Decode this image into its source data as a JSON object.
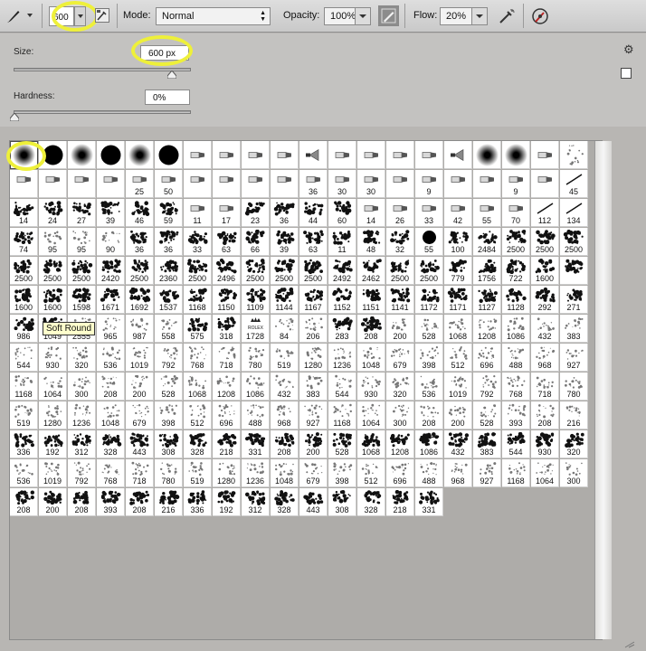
{
  "toolbar": {
    "size_value": "600",
    "mode_label": "Mode:",
    "mode_value": "Normal",
    "opacity_label": "Opacity:",
    "opacity_value": "100%",
    "flow_label": "Flow:",
    "flow_value": "20%",
    "icons": [
      "brush-tool-icon",
      "tool-preset-chevron-icon",
      "brush-panel-toggle-icon",
      "pressure-opacity-icon",
      "airbrush-icon",
      "pressure-size-icon"
    ]
  },
  "panel": {
    "size_label": "Size:",
    "size_value": "600 px",
    "size_slider_fraction": 0.6,
    "hardness_label": "Hardness:",
    "hardness_value": "0%",
    "hardness_slider_fraction": 0.0,
    "icons": [
      "gear-icon",
      "new-preset-icon"
    ]
  },
  "tooltip": "Soft Round",
  "colors": {
    "highlight": "#eef03a",
    "panel": "#c3c2c0",
    "picker_bg": "#aeaca9"
  },
  "presets": {
    "rows": [
      [
        "",
        "",
        "",
        "",
        "",
        "",
        "",
        "",
        "",
        "",
        "",
        "",
        "",
        "",
        "",
        "",
        "",
        "",
        "",
        ""
      ],
      [
        "",
        "",
        "",
        "",
        "25",
        "50",
        "",
        "",
        "",
        "",
        "36",
        "30",
        "30",
        "",
        "9",
        "",
        "",
        "9",
        "",
        "45"
      ],
      [
        "14",
        "24",
        "27",
        "39",
        "46",
        "59",
        "11",
        "17",
        "23",
        "36",
        "44",
        "60",
        "14",
        "26",
        "33",
        "42",
        "55",
        "70",
        "112",
        "134"
      ],
      [
        "74",
        "95",
        "95",
        "90",
        "36",
        "36",
        "33",
        "63",
        "66",
        "39",
        "63",
        "11",
        "48",
        "32",
        "55",
        "100",
        "2484",
        "2500",
        "2500",
        "2500"
      ],
      [
        "2500",
        "2500",
        "2500",
        "2420",
        "2500",
        "2360",
        "2500",
        "2496",
        "2500",
        "2500",
        "2500",
        "2492",
        "2462",
        "2500",
        "2500",
        "779",
        "1756",
        "722",
        "1600",
        ""
      ],
      [
        "1600",
        "1600",
        "1598",
        "1671",
        "1692",
        "1537",
        "1168",
        "1150",
        "1109",
        "1144",
        "1167",
        "1152",
        "1151",
        "1141",
        "1172",
        "1171",
        "1127",
        "1128",
        "292",
        "271"
      ],
      [
        "986",
        "1049",
        "2555",
        "965",
        "987",
        "558",
        "575",
        "318",
        "1728",
        "84",
        "206",
        "283",
        "208",
        "200",
        "528",
        "1068",
        "1208",
        "1086",
        "432",
        "383"
      ],
      [
        "544",
        "930",
        "320",
        "536",
        "1019",
        "792",
        "768",
        "718",
        "780",
        "519",
        "1280",
        "1236",
        "1048",
        "679",
        "398",
        "512",
        "696",
        "488",
        "968",
        "927"
      ],
      [
        "1168",
        "1064",
        "300",
        "208",
        "200",
        "528",
        "1068",
        "1208",
        "1086",
        "432",
        "383",
        "544",
        "930",
        "320",
        "536",
        "1019",
        "792",
        "768",
        "718",
        "780"
      ],
      [
        "519",
        "1280",
        "1236",
        "1048",
        "679",
        "398",
        "512",
        "696",
        "488",
        "968",
        "927",
        "1168",
        "1064",
        "300",
        "208",
        "200",
        "528",
        "393",
        "208",
        "216"
      ],
      [
        "336",
        "192",
        "312",
        "328",
        "443",
        "308",
        "328",
        "218",
        "331",
        "208",
        "200",
        "528",
        "1068",
        "1208",
        "1086",
        "432",
        "383",
        "544",
        "930",
        "320"
      ],
      [
        "536",
        "1019",
        "792",
        "768",
        "718",
        "780",
        "519",
        "1280",
        "1236",
        "1048",
        "679",
        "398",
        "512",
        "696",
        "488",
        "968",
        "927",
        "1168",
        "1064",
        "300"
      ],
      [
        "208",
        "200",
        "208",
        "393",
        "208",
        "216",
        "336",
        "192",
        "312",
        "328",
        "443",
        "308",
        "328",
        "218",
        "331"
      ]
    ],
    "row0_types": [
      "soft",
      "hard",
      "soft",
      "hard",
      "soft",
      "hard",
      "tip",
      "tip",
      "tip",
      "tip",
      "fan",
      "tip",
      "tip",
      "tip",
      "tip",
      "fan",
      "soft",
      "soft",
      "tip",
      "star"
    ],
    "row0_type_names": {
      "soft": "soft-round-brush-icon",
      "hard": "hard-round-brush-icon",
      "tip": "bristle-tip-brush-icon",
      "fan": "fan-brush-icon",
      "star": "scatter-brush-icon"
    },
    "special_labels": {
      "rolex": "ROLEX"
    }
  }
}
